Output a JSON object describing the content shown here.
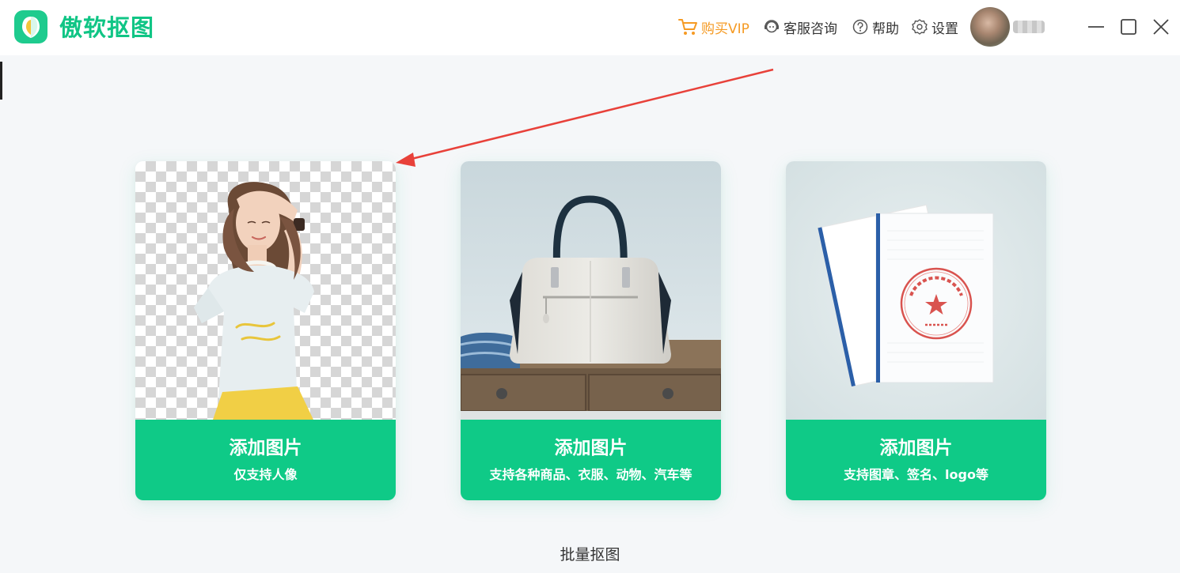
{
  "app": {
    "name": "傲软抠图",
    "brand_color": "#10c585"
  },
  "titlebar": {
    "vip_label": "购买VIP",
    "service_label": "客服咨询",
    "help_label": "帮助",
    "settings_label": "设置",
    "icons": [
      "cart-icon",
      "headset-icon",
      "help-icon",
      "gear-icon",
      "minimize-icon",
      "maximize-icon",
      "close-icon"
    ],
    "vip_color": "#f59a23"
  },
  "cards": [
    {
      "title": "添加图片",
      "subtitle": "仅支持人像",
      "image": "portrait-cutout"
    },
    {
      "title": "添加图片",
      "subtitle": "支持各种商品、衣服、动物、汽车等",
      "image": "handbag-product"
    },
    {
      "title": "添加图片",
      "subtitle": "支持图章、签名、logo等",
      "image": "stamped-document"
    }
  ],
  "card_accent": "#0fca87",
  "batch_label": "批量抠图",
  "annotation": {
    "arrow_color": "#e8413a"
  }
}
